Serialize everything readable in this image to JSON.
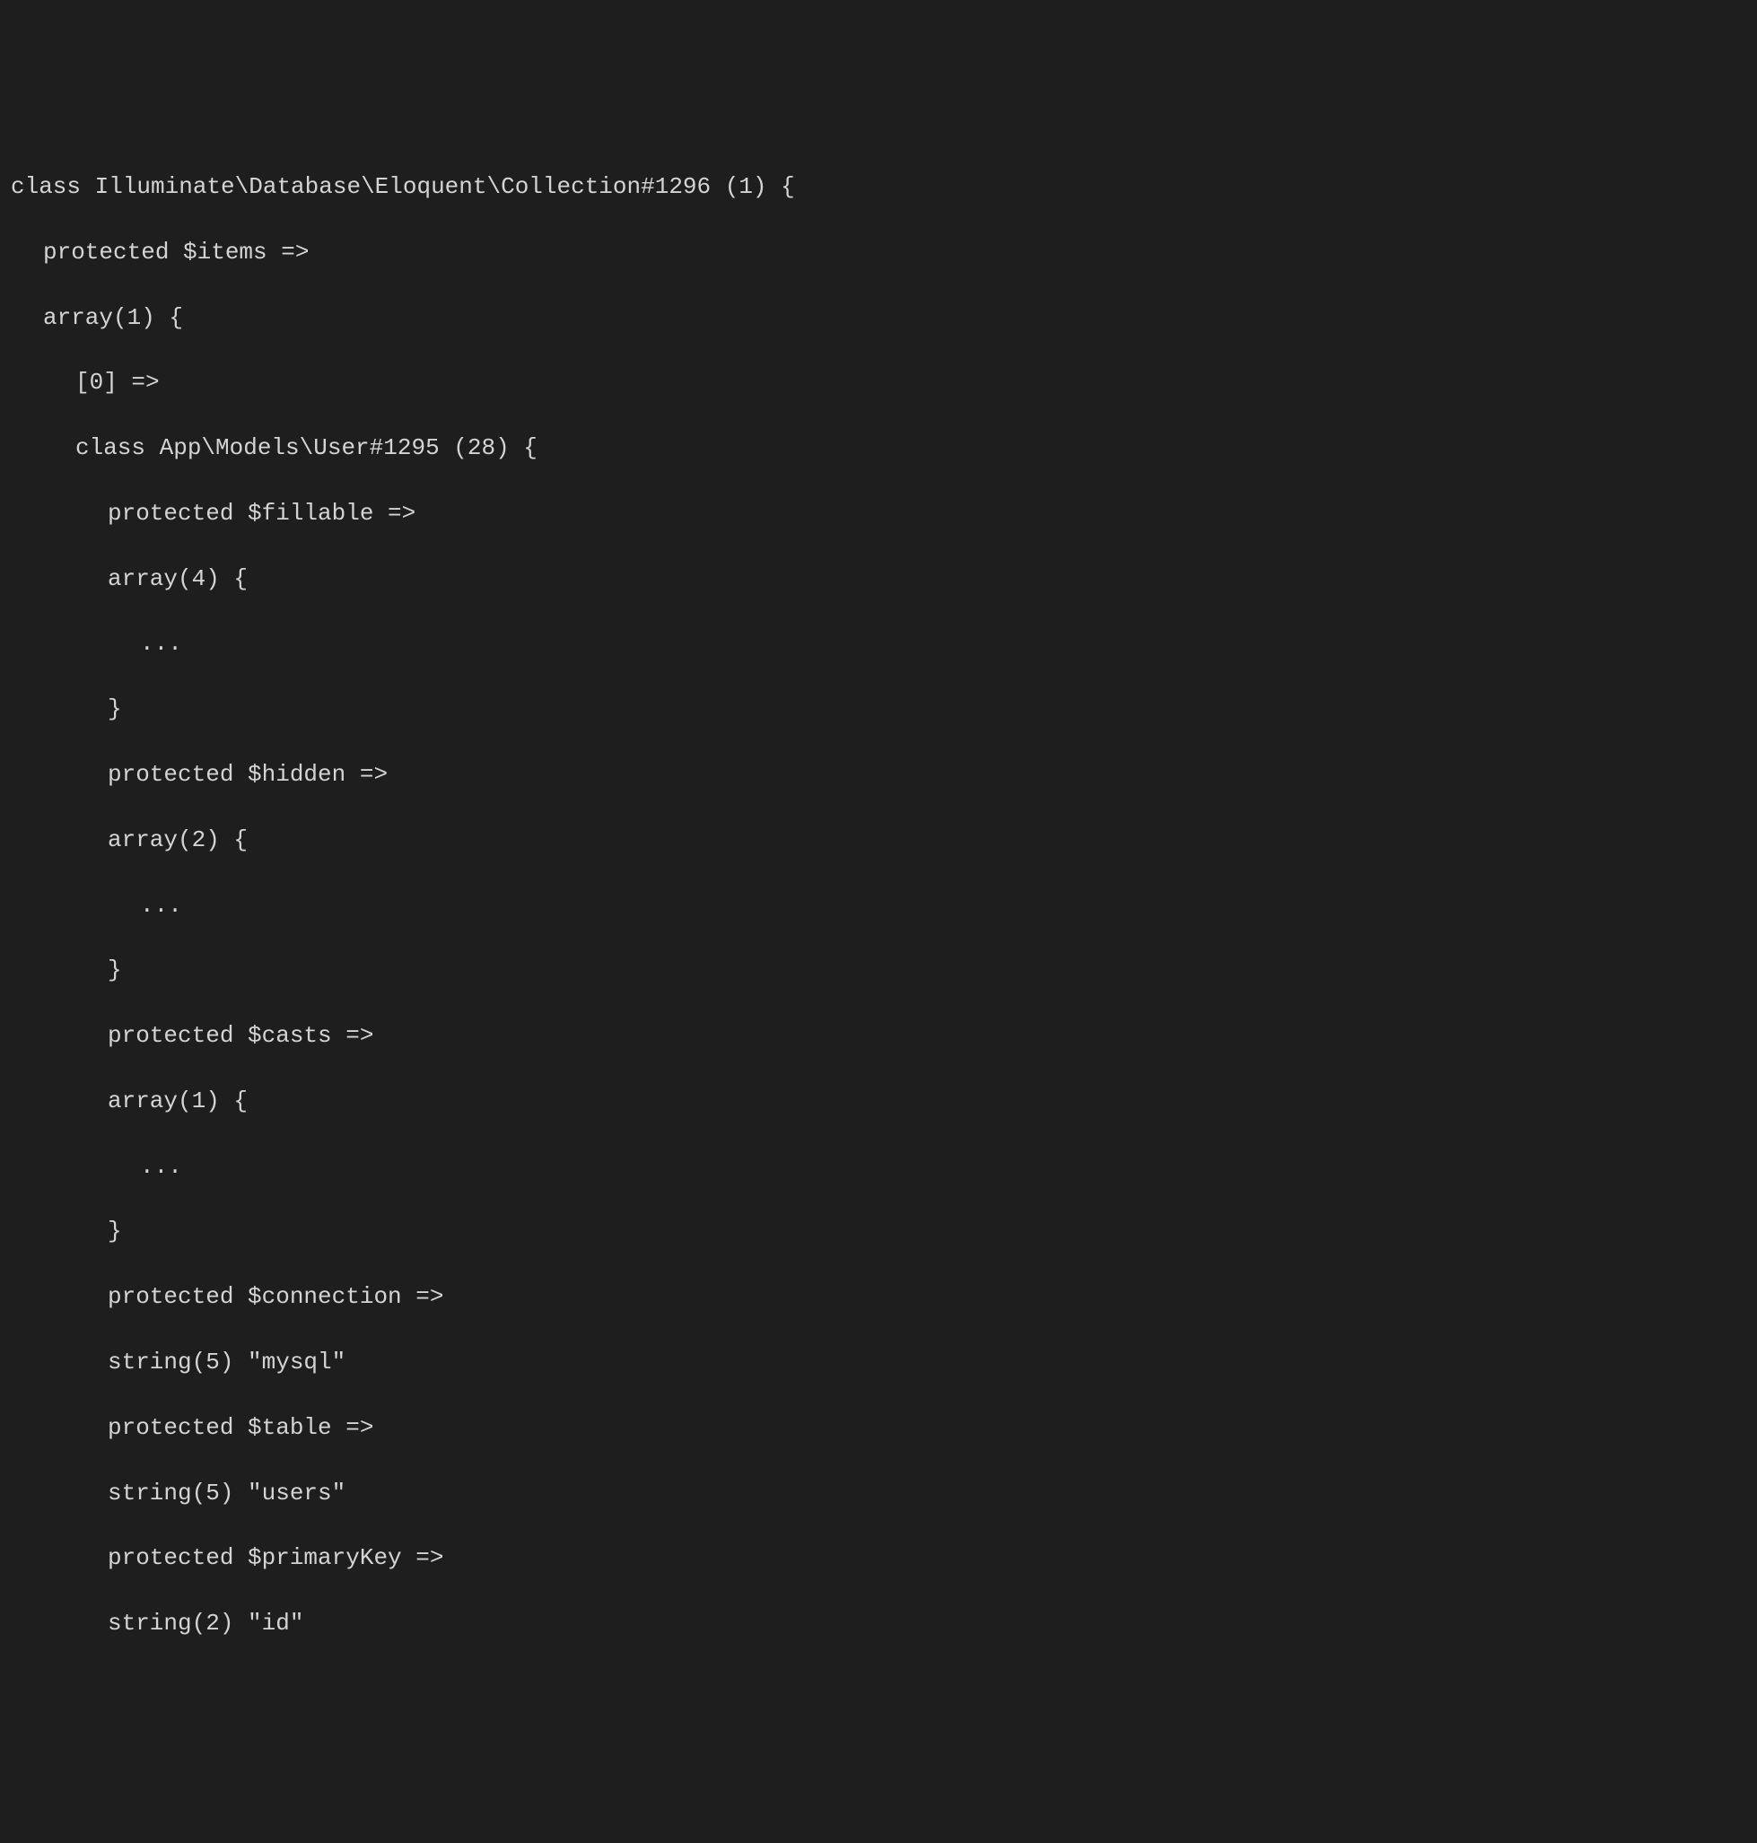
{
  "dump": {
    "line1": "class Illuminate\\Database\\Eloquent\\Collection#1296 (1) {",
    "line2": "protected $items =>",
    "line3": "array(1) {",
    "line4": "[0] =>",
    "line5": "class App\\Models\\User#1295 (28) {",
    "line6": "protected $fillable =>",
    "line7": "array(4) {",
    "line8": "...",
    "line9": "}",
    "line10": "protected $hidden =>",
    "line11": "array(2) {",
    "line12": "...",
    "line13": "}",
    "line14": "protected $casts =>",
    "line15": "array(1) {",
    "line16": "...",
    "line17": "}",
    "line18": "protected $connection =>",
    "line19": "string(5) \"mysql\"",
    "line20": "protected $table =>",
    "line21": "string(5) \"users\"",
    "line22": "protected $primaryKey =>",
    "line23": "string(2) \"id\""
  }
}
